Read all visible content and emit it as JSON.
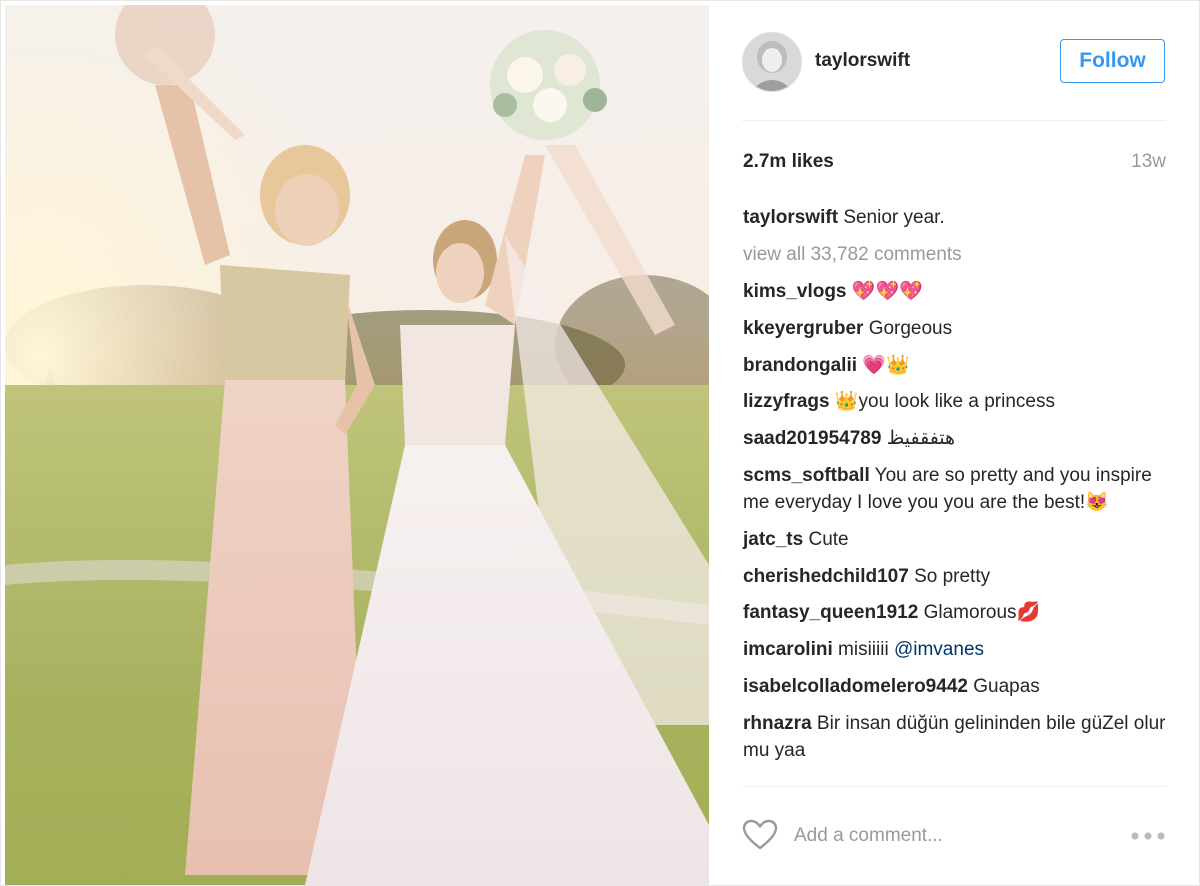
{
  "post": {
    "username": "taylorswift",
    "follow_label": "Follow",
    "likes": "2.7m likes",
    "age": "13w",
    "caption": {
      "user": "taylorswift",
      "text": "Senior year."
    },
    "view_all": "view all 33,782 comments",
    "comments": [
      {
        "user": "kims_vlogs",
        "text": "💖💖💖"
      },
      {
        "user": "kkeyergruber",
        "text": "Gorgeous"
      },
      {
        "user": "brandongalii",
        "text": "💗👑"
      },
      {
        "user": "lizzyfrags",
        "text": "👑you look like a princess"
      },
      {
        "user": "saad201954789",
        "text": "هتفقفيظ"
      },
      {
        "user": "scms_softball",
        "text": "You are so pretty and you inspire me everyday I love you you are the best!😻"
      },
      {
        "user": "jatc_ts",
        "text": "Cute"
      },
      {
        "user": "cherishedchild107",
        "text": "So pretty"
      },
      {
        "user": "fantasy_queen1912",
        "text": "Glamorous💋"
      },
      {
        "user": "imcarolini",
        "text": "misiiiii ",
        "mention": "@imvanes"
      },
      {
        "user": "isabelcolladomelero9442",
        "text": "Guapas"
      },
      {
        "user": "rhnazra",
        "text": "Bir insan düğün gelininden bile güZel olur mu yaa"
      }
    ],
    "add_comment_placeholder": "Add a comment...",
    "icons": {
      "like": "heart-outline-icon",
      "more": "more-options-icon"
    },
    "colors": {
      "accent": "#3897f0",
      "muted": "#999999",
      "text": "#262626"
    }
  }
}
